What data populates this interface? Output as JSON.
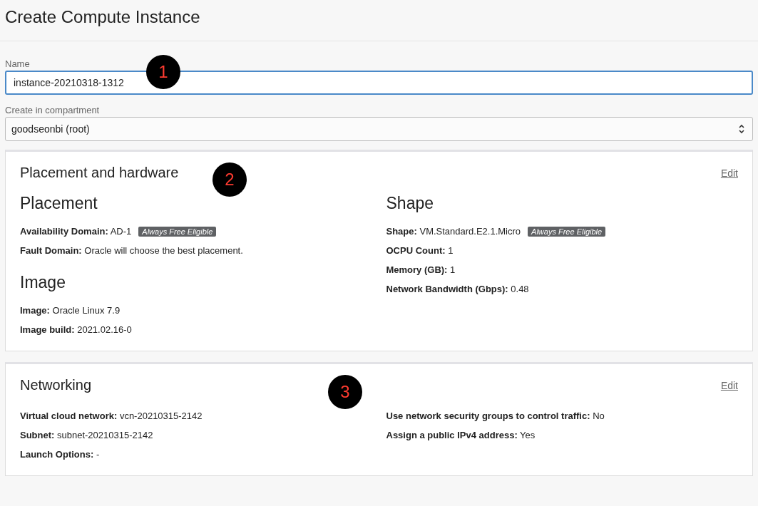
{
  "page": {
    "title": "Create Compute Instance"
  },
  "fields": [
    {
      "label": "Name",
      "value": "instance-20210318-1312",
      "kind": "input",
      "focused": true,
      "marker": "1"
    },
    {
      "label": "Create in compartment",
      "value": "goodseonbi (root)",
      "kind": "select",
      "focused": false
    }
  ],
  "sections": [
    {
      "title": "Placement and hardware",
      "edit": "Edit",
      "marker": "2",
      "columns": [
        [
          {
            "heading": "Placement",
            "rows": [
              {
                "text": "**Availability Domain:** AD-1",
                "badge": "Always Free Eligible"
              },
              {
                "text": "**Fault Domain:** Oracle will choose the best placement."
              }
            ]
          },
          {
            "heading": "Image",
            "rows": [
              {
                "text": "**Image:** Oracle Linux 7.9"
              },
              {
                "text": "**Image build:** 2021.02.16-0"
              }
            ]
          }
        ],
        [
          {
            "heading": "Shape",
            "rows": [
              {
                "text": "**Shape:** VM.Standard.E2.1.Micro",
                "badge": "Always Free Eligible"
              },
              {
                "text": "**OCPU Count:** 1"
              },
              {
                "text": "**Memory (GB):** 1"
              },
              {
                "text": "**Network Bandwidth (Gbps):** 0.48"
              }
            ]
          }
        ]
      ]
    },
    {
      "title": "Networking",
      "edit": "Edit",
      "marker": "3",
      "columns": [
        [
          {
            "rows": [
              {
                "text": "**Virtual cloud network:** vcn-20210315-2142"
              },
              {
                "text": "**Subnet:** subnet-20210315-2142"
              },
              {
                "text": "**Launch Options:** -"
              }
            ]
          }
        ],
        [
          {
            "rows": [
              {
                "text": "**Use network security groups to control traffic:** No"
              },
              {
                "text": "**Assign a public IPv4 address:** Yes"
              }
            ]
          }
        ]
      ]
    }
  ]
}
